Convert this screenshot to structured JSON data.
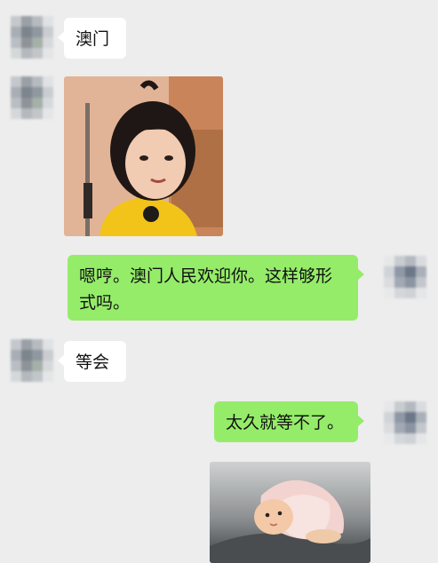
{
  "messages": [
    {
      "side": "in",
      "type": "text",
      "text": "澳门"
    },
    {
      "side": "in",
      "type": "image",
      "image": "girl-sticker"
    },
    {
      "side": "out",
      "type": "text",
      "text": "嗯哼。澳门人民欢迎你。这样够形式吗。"
    },
    {
      "side": "in",
      "type": "text",
      "text": "等会"
    },
    {
      "side": "out",
      "type": "text",
      "text": "太久就等不了。"
    },
    {
      "side": "out",
      "type": "image",
      "image": "baby-sticker"
    }
  ],
  "colors": {
    "background": "#ededed",
    "incoming_bubble": "#ffffff",
    "outgoing_bubble": "#95ec69"
  }
}
